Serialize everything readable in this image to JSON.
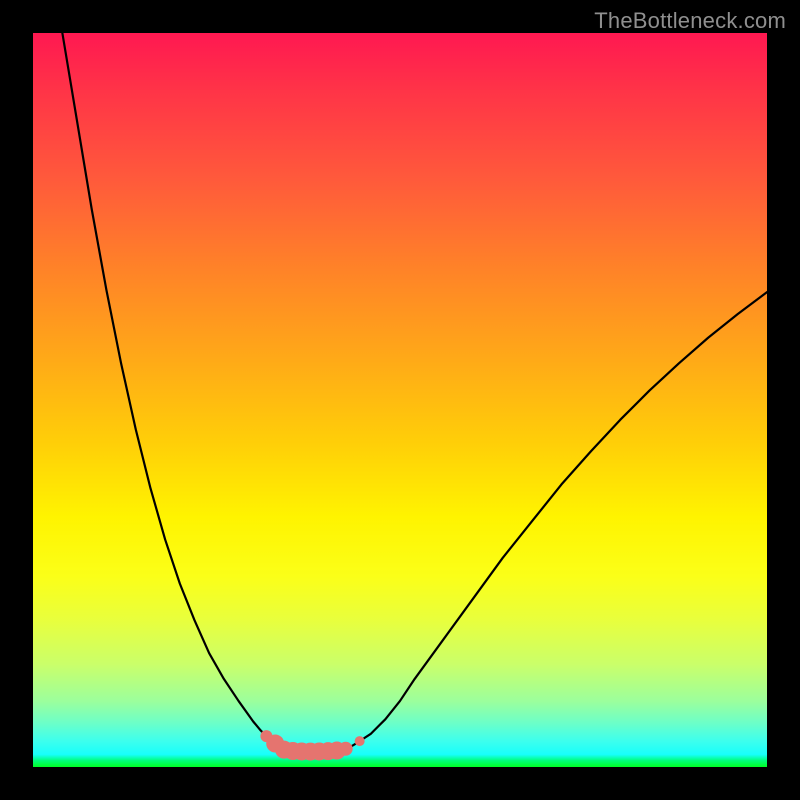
{
  "watermark": "TheBottleneck.com",
  "chart_data": {
    "type": "line",
    "title": "",
    "xlabel": "",
    "ylabel": "",
    "xlim": [
      0,
      100
    ],
    "ylim": [
      0,
      100
    ],
    "grid": false,
    "legend": false,
    "series": [
      {
        "name": "left-curve",
        "x": [
          4,
          6,
          8,
          10,
          12,
          14,
          16,
          18,
          20,
          22,
          24,
          26,
          28,
          30,
          31,
          32,
          33,
          33.5,
          34
        ],
        "values": [
          100,
          88,
          76,
          65,
          55,
          46,
          38,
          31,
          25,
          20,
          15.5,
          12,
          9,
          6.2,
          5,
          4,
          3.2,
          2.7,
          2.4
        ]
      },
      {
        "name": "right-curve",
        "x": [
          42,
          43,
          44,
          46,
          48,
          50,
          52,
          56,
          60,
          64,
          68,
          72,
          76,
          80,
          84,
          88,
          92,
          96,
          100
        ],
        "values": [
          2.3,
          2.6,
          3.2,
          4.5,
          6.5,
          9,
          12,
          17.5,
          23,
          28.5,
          33.5,
          38.5,
          43,
          47.3,
          51.3,
          55,
          58.5,
          61.7,
          64.7
        ]
      },
      {
        "name": "valley-floor",
        "x": [
          34,
          35,
          36,
          37,
          38,
          39,
          40,
          41,
          42
        ],
        "values": [
          2.4,
          2.2,
          2.15,
          2.1,
          2.1,
          2.12,
          2.15,
          2.2,
          2.3
        ]
      }
    ],
    "markers": [
      {
        "name": "pink-markers",
        "color": "#e5746f",
        "points": [
          {
            "x": 31.8,
            "r": 6
          },
          {
            "x": 33.0,
            "r": 9
          },
          {
            "x": 34.2,
            "r": 9
          },
          {
            "x": 35.4,
            "r": 9
          },
          {
            "x": 36.6,
            "r": 9
          },
          {
            "x": 37.8,
            "r": 9
          },
          {
            "x": 39.0,
            "r": 9
          },
          {
            "x": 40.2,
            "r": 9
          },
          {
            "x": 41.4,
            "r": 9
          },
          {
            "x": 42.6,
            "r": 7
          },
          {
            "x": 44.5,
            "r": 5
          }
        ]
      }
    ]
  }
}
